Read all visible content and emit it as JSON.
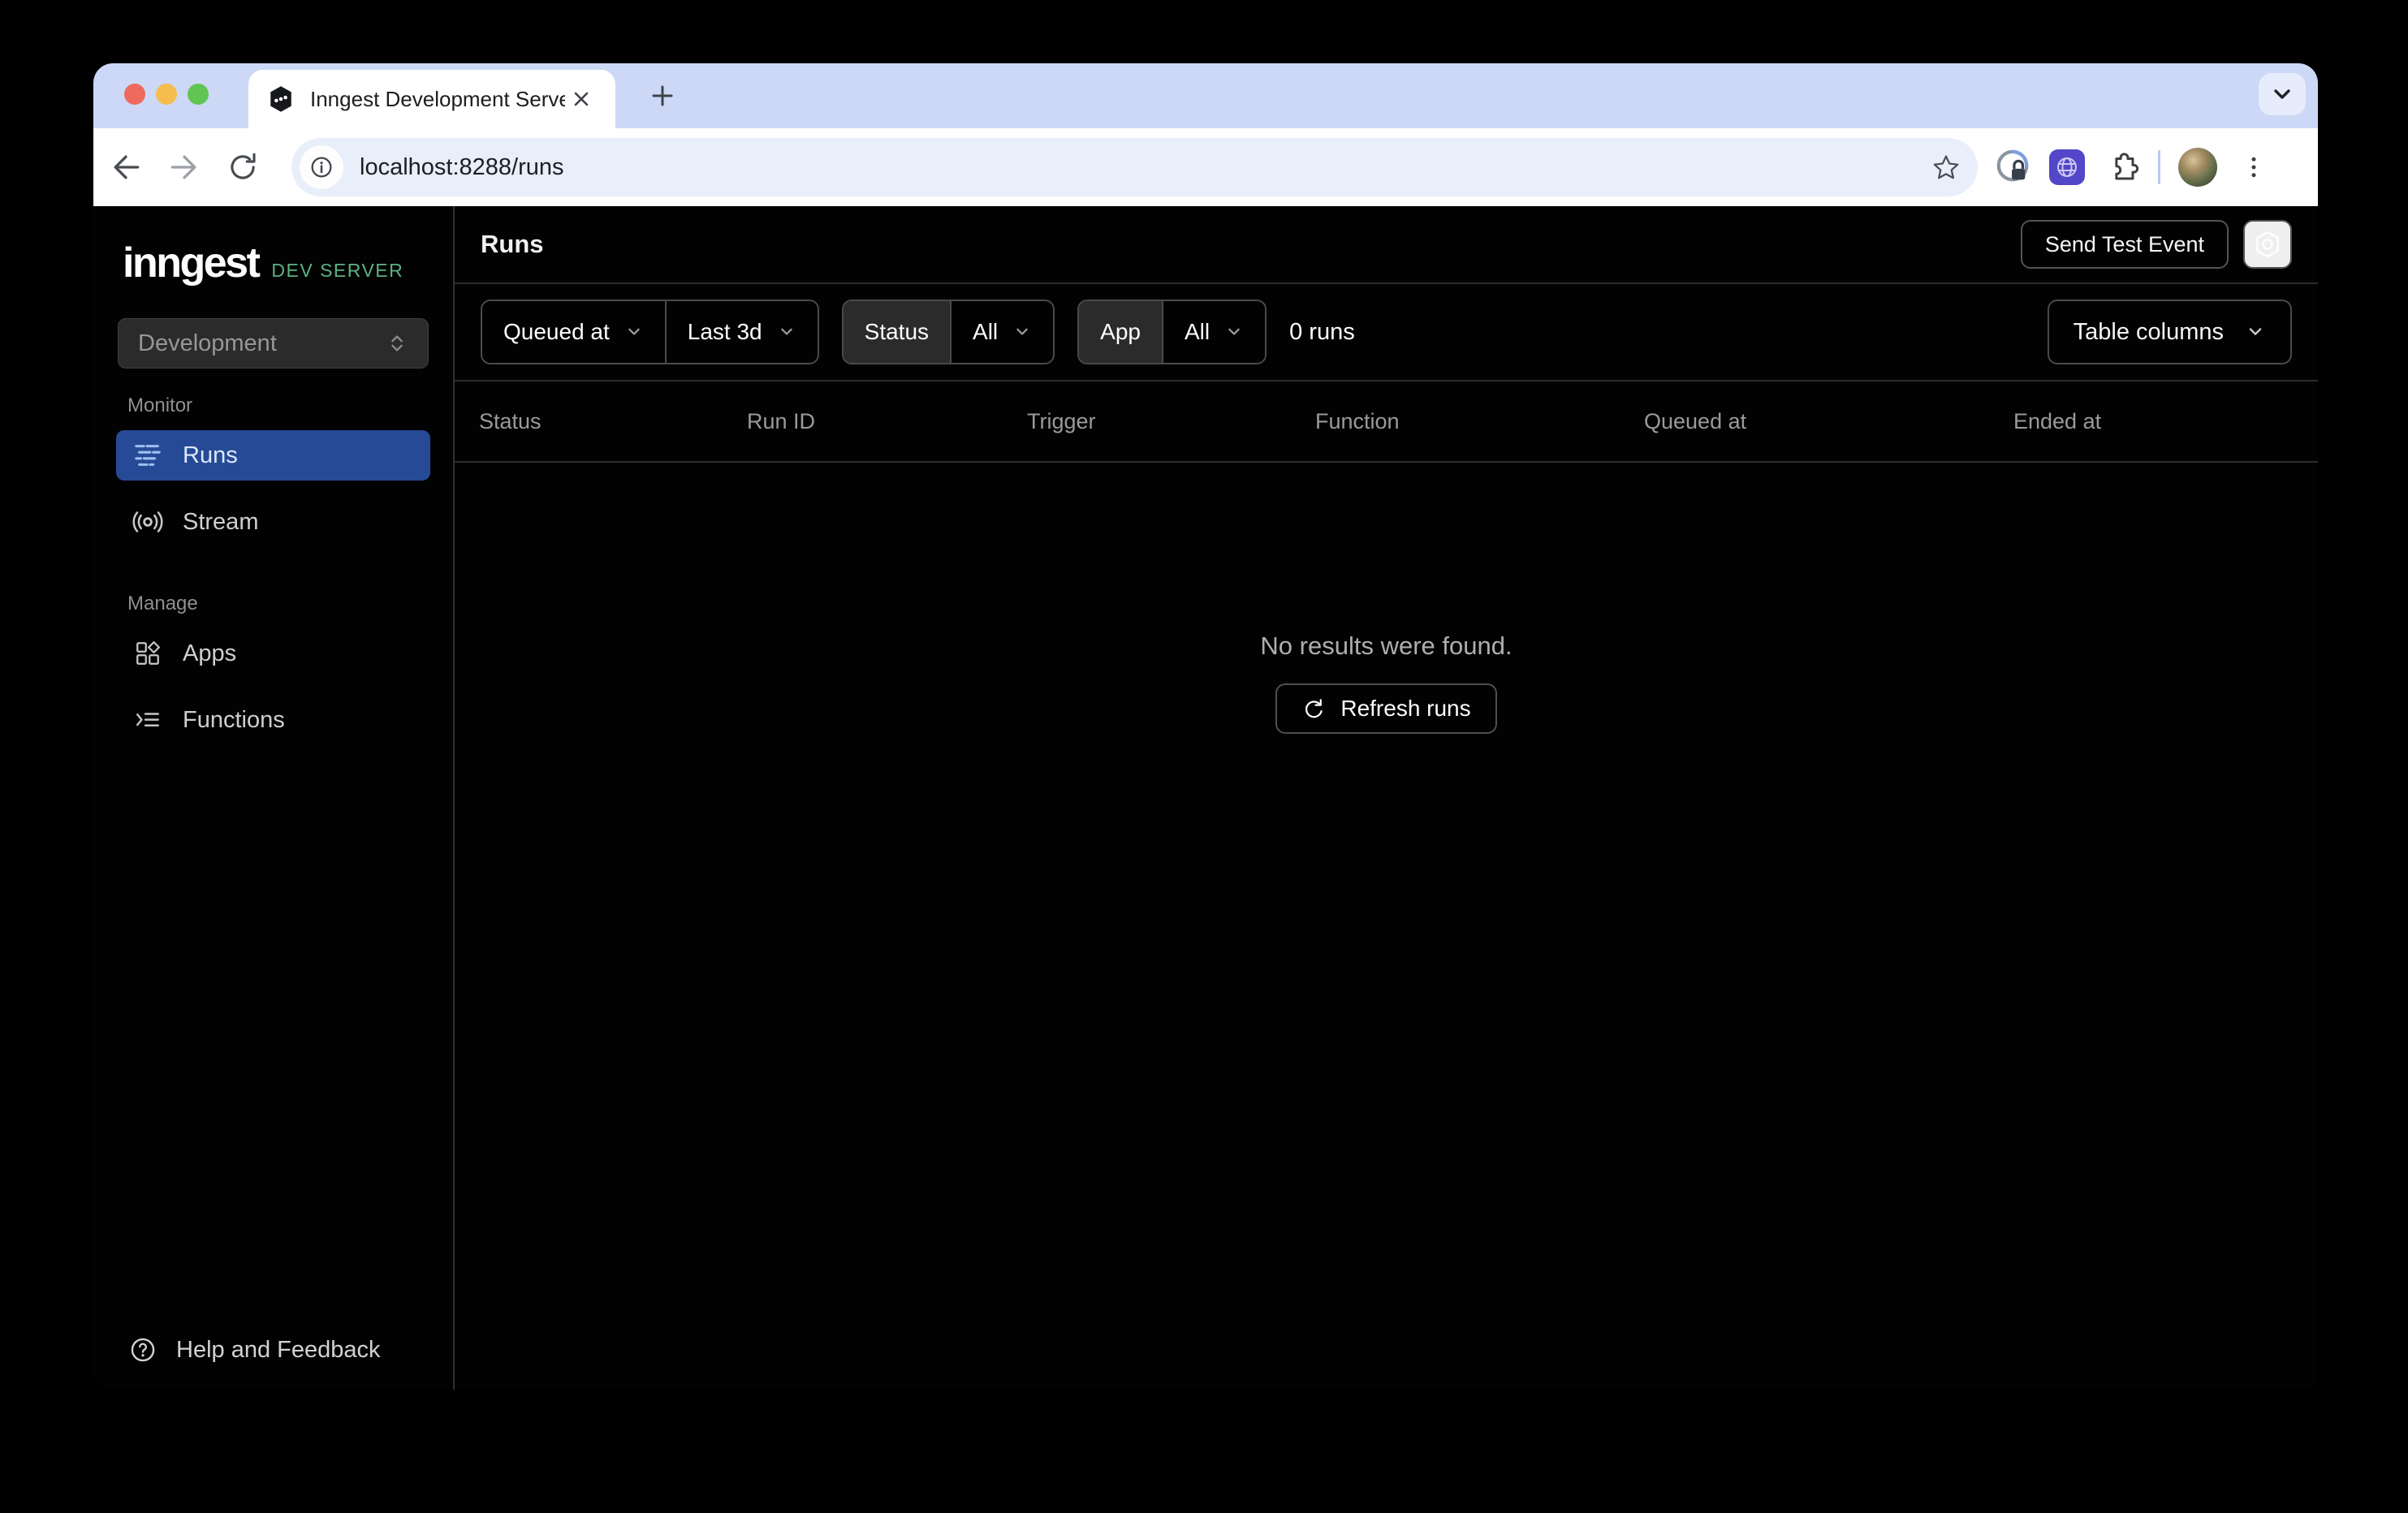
{
  "browser": {
    "tab_title": "Inngest Development Server",
    "url": "localhost:8288/runs"
  },
  "sidebar": {
    "logo": "inngest",
    "logo_tag": "DEV SERVER",
    "env_select_value": "Development",
    "sections": [
      {
        "label": "Monitor",
        "items": [
          {
            "label": "Runs",
            "active": true
          },
          {
            "label": "Stream",
            "active": false
          }
        ]
      },
      {
        "label": "Manage",
        "items": [
          {
            "label": "Apps",
            "active": false
          },
          {
            "label": "Functions",
            "active": false
          }
        ]
      }
    ],
    "help_label": "Help and Feedback"
  },
  "header": {
    "title": "Runs",
    "send_test_event_label": "Send Test Event"
  },
  "filters": {
    "time_field": "Queued at",
    "time_range": "Last 3d",
    "status_label": "Status",
    "status_value": "All",
    "app_label": "App",
    "app_value": "All",
    "runs_count": "0 runs",
    "table_columns_label": "Table columns"
  },
  "table": {
    "columns": [
      "Status",
      "Run ID",
      "Trigger",
      "Function",
      "Queued at",
      "Ended at"
    ]
  },
  "empty_state": {
    "message": "No results were found.",
    "refresh_label": "Refresh runs"
  },
  "colors": {
    "accent_green": "#5cb283",
    "active_nav_bg": "#264a96",
    "tabstrip_bg": "#ccd8f6",
    "app_bg": "#020202"
  }
}
